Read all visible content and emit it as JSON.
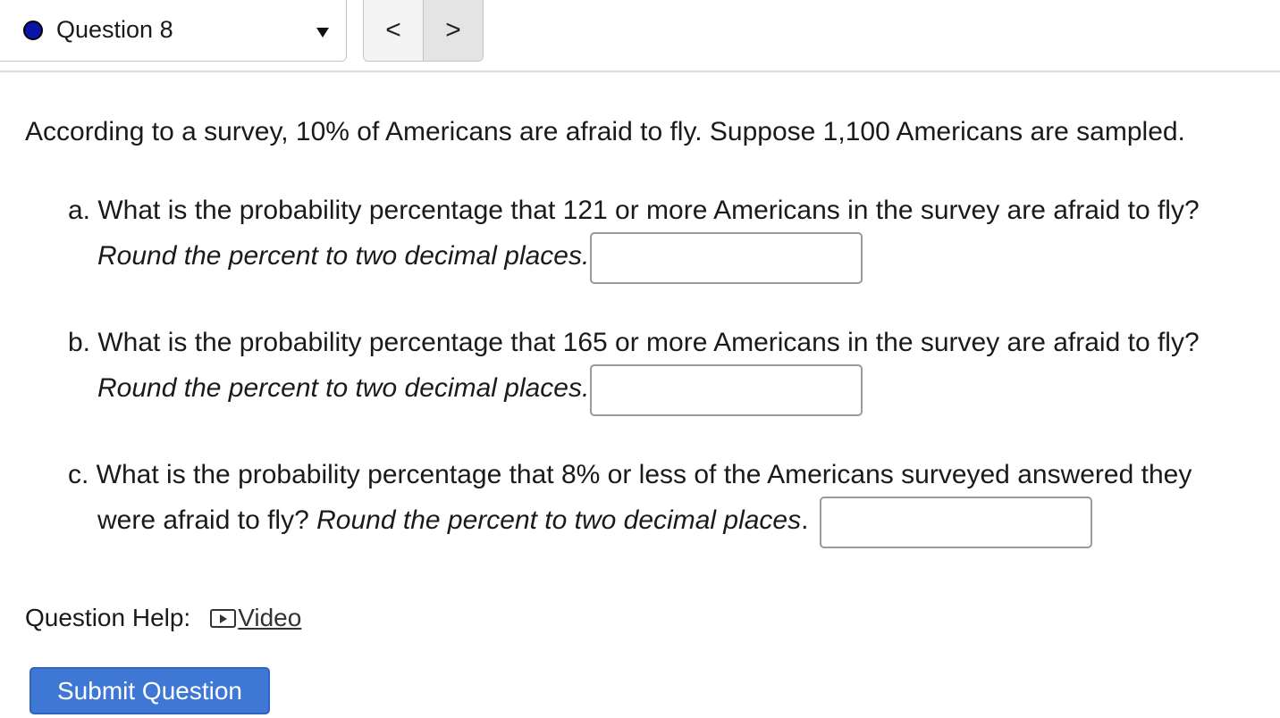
{
  "header": {
    "question_label": "Question 8",
    "prev_label": "<",
    "next_label": ">"
  },
  "intro": "According to a survey, 10% of Americans are afraid to fly. Suppose 1,100 Americans are sampled.",
  "parts": [
    {
      "text": "a. What is the probability percentage that 121 or more Americans in the survey are afraid to fly?",
      "instruction": "Round the percent to two decimal places.",
      "value": ""
    },
    {
      "text": "b. What is the probability percentage that 165 or more Americans in the survey are afraid to fly?",
      "instruction": "Round the percent to two decimal places.",
      "value": ""
    },
    {
      "text": "c. What is the probability percentage that 8% or less of the Americans surveyed answered they",
      "line2": "were afraid to fly?",
      "instruction": "Round the percent to two decimal places",
      "period": ".",
      "value": ""
    }
  ],
  "help": {
    "label": "Question Help:",
    "video_label": "Video"
  },
  "submit_label": "Submit Question",
  "colors": {
    "accent": "#3f78d4",
    "status_dot": "#0b14a8"
  }
}
